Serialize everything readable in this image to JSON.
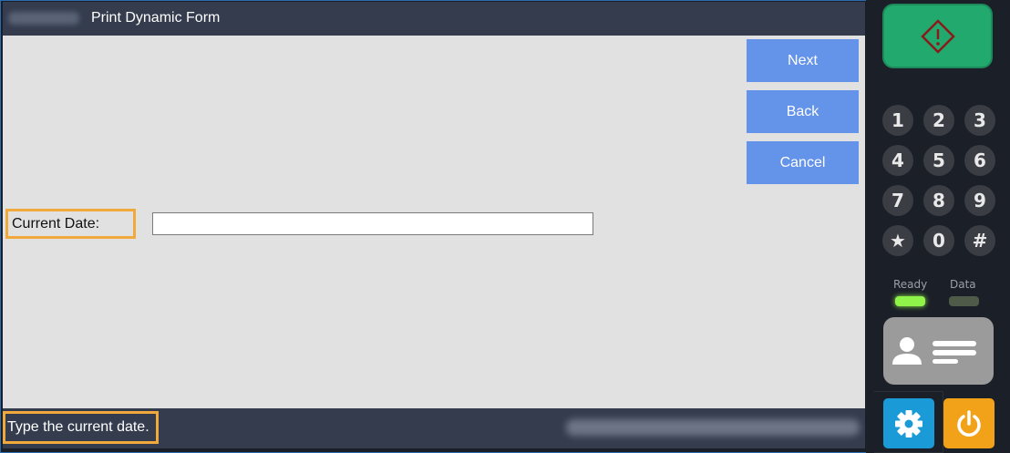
{
  "titlebar": {
    "title": "Print Dynamic Form"
  },
  "actions": {
    "next_label": "Next",
    "back_label": "Back",
    "cancel_label": "Cancel"
  },
  "form": {
    "current_date_label": "Current Date:",
    "current_date_value": ""
  },
  "statusbar": {
    "message": "Type the current date."
  },
  "panel": {
    "start_icon": "diamond-start-icon",
    "keypad": [
      "1",
      "2",
      "3",
      "4",
      "5",
      "6",
      "7",
      "8",
      "9",
      "★",
      "0",
      "#"
    ],
    "ready_label": "Ready",
    "data_label": "Data",
    "card_icon": "id-card-icon",
    "settings_icon": "gear-icon",
    "power_icon": "power-icon"
  },
  "colors": {
    "titlebar": "#343c4e",
    "button_blue": "#6493ea",
    "highlight": "#f2a93b",
    "start_green": "#22a96e",
    "settings_blue": "#1a9bd7",
    "power_orange": "#f2a218",
    "ready_led": "#8ff34a"
  }
}
